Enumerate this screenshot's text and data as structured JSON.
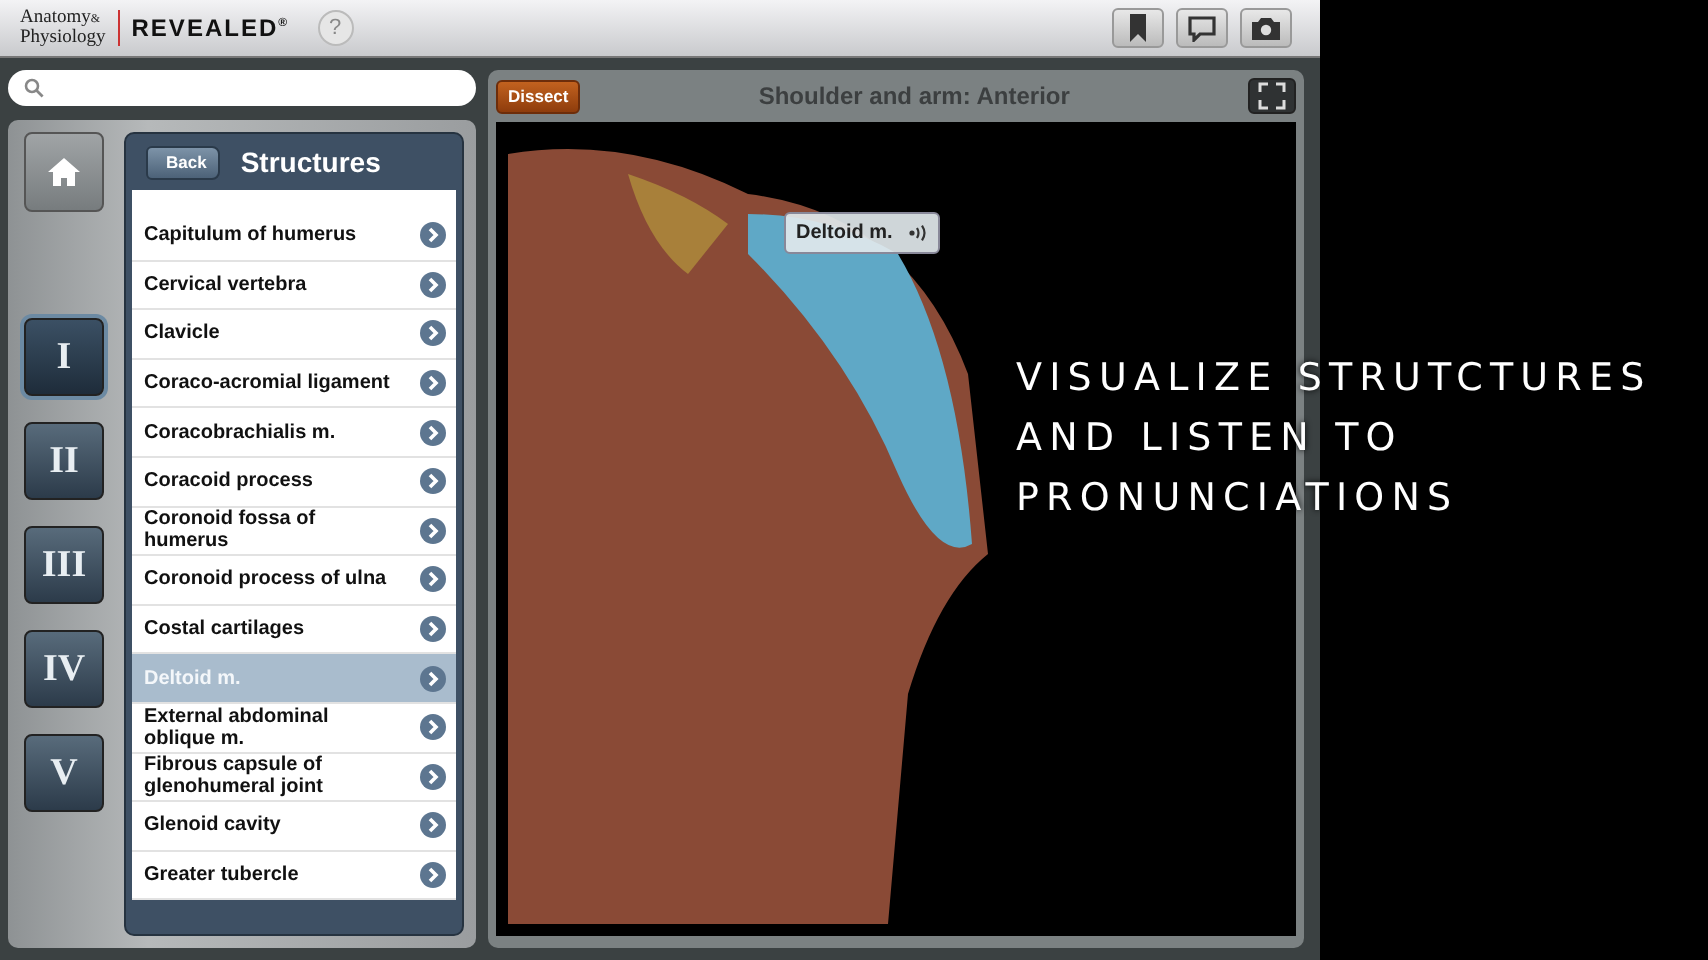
{
  "header": {
    "logo_top": "Anatomy",
    "logo_amp": "&",
    "logo_bottom": "Physiology",
    "brand": "REVEALED",
    "brand_mark": "®",
    "help": "?"
  },
  "sections": [
    {
      "label": "I",
      "selected": true
    },
    {
      "label": "II",
      "selected": false
    },
    {
      "label": "III",
      "selected": false
    },
    {
      "label": "IV",
      "selected": false
    },
    {
      "label": "V",
      "selected": false
    }
  ],
  "structures": {
    "back": "Back",
    "title": "Structures",
    "items": [
      {
        "label": "Capitulum of humerus",
        "selected": false
      },
      {
        "label": "Cervical vertebra",
        "selected": false
      },
      {
        "label": "Clavicle",
        "selected": false
      },
      {
        "label": "Coraco-acromial ligament",
        "selected": false
      },
      {
        "label": "Coracobrachialis m.",
        "selected": false
      },
      {
        "label": "Coracoid process",
        "selected": false
      },
      {
        "label": "Coronoid fossa of humerus",
        "selected": false
      },
      {
        "label": "Coronoid process of ulna",
        "selected": false
      },
      {
        "label": "Costal cartilages",
        "selected": false
      },
      {
        "label": "Deltoid m.",
        "selected": true
      },
      {
        "label": "External abdominal oblique m.",
        "selected": false
      },
      {
        "label": "Fibrous capsule of glenohumeral joint",
        "selected": false
      },
      {
        "label": "Glenoid cavity",
        "selected": false
      },
      {
        "label": "Greater tubercle",
        "selected": false
      }
    ]
  },
  "viewer": {
    "dissect": "Dissect",
    "title": "Shoulder and arm: Anterior",
    "label": "Deltoid m."
  },
  "caption": [
    "VISUALIZE STRUTCTURES",
    "AND LISTEN TO",
    "PRONUNCIATIONS"
  ]
}
